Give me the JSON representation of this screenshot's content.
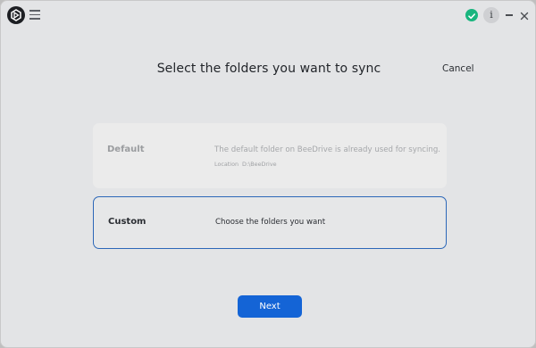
{
  "titlebar": {
    "info_label": "i"
  },
  "header": {
    "title": "Select the folders you want to sync",
    "cancel_label": "Cancel"
  },
  "options": [
    {
      "name": "Default",
      "description": "The default folder on BeeDrive is already used for syncing.",
      "location_label": "Location",
      "location_value": "D:\\BeeDrive",
      "state": "disabled"
    },
    {
      "name": "Custom",
      "description": "Choose the folders you want",
      "state": "selected"
    }
  ],
  "footer": {
    "next_label": "Next"
  },
  "colors": {
    "accent": "#1464d6",
    "selected_border": "#2c67b8",
    "status_ok": "#19b57e"
  },
  "icons": {
    "logo": "app-logo-icon",
    "menu": "hamburger-menu-icon",
    "status": "sync-ok-check-icon",
    "info": "info-icon",
    "minimize": "minimize-icon",
    "close": "close-icon"
  }
}
